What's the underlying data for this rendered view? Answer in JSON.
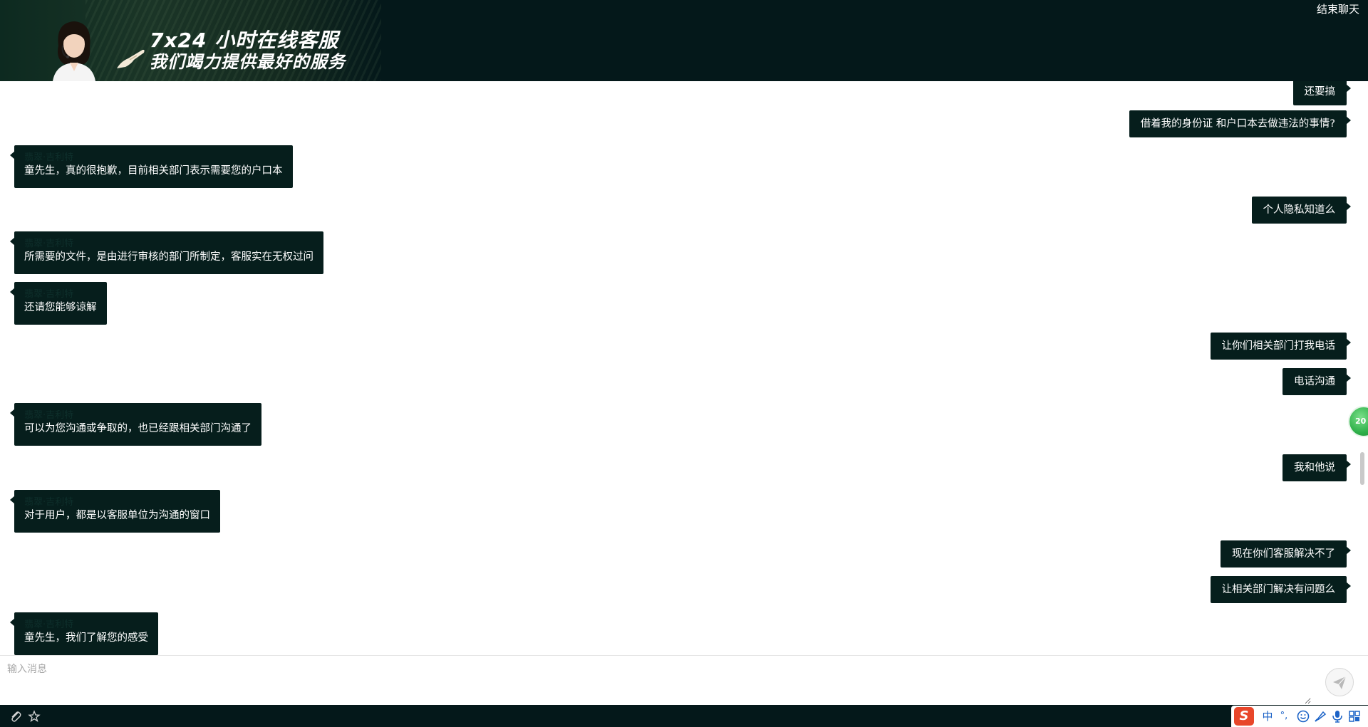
{
  "header": {
    "banner_line1": "7x24 小时在线客服",
    "banner_line2": "我们竭力提供最好的服务",
    "end_chat_label": "结束聊天"
  },
  "messages": [
    {
      "side": "right",
      "text": "还要搞"
    },
    {
      "side": "right",
      "text": "借着我的身份证 和户口本去做违法的事情?"
    },
    {
      "side": "left",
      "sender": "翡翠·吉利特",
      "text": "童先生，真的很抱歉，目前相关部门表示需要您的户口本"
    },
    {
      "side": "right",
      "text": "个人隐私知道么"
    },
    {
      "side": "left",
      "sender": "翡翠·吉利特",
      "text": "所需要的文件，是由进行审核的部门所制定，客服实在无权过问"
    },
    {
      "side": "left",
      "sender": "翡翠·吉利特",
      "text": "还请您能够谅解"
    },
    {
      "side": "right",
      "text": "让你们相关部门打我电话"
    },
    {
      "side": "right",
      "text": "电话沟通"
    },
    {
      "side": "left",
      "sender": "翡翠·吉利特",
      "text": "可以为您沟通或争取的，也已经跟相关部门沟通了"
    },
    {
      "side": "right",
      "text": "我和他说"
    },
    {
      "side": "left",
      "sender": "翡翠·吉利特",
      "text": "对于用户，都是以客服单位为沟通的窗口"
    },
    {
      "side": "right",
      "text": "现在你们客服解决不了"
    },
    {
      "side": "right",
      "text": "让相关部门解决有问题么"
    },
    {
      "side": "left",
      "sender": "翡翠·吉利特",
      "text": "童先生，我们了解您的感受"
    }
  ],
  "float_badge": "20",
  "input": {
    "placeholder": "输入消息",
    "value": ""
  },
  "ime": {
    "logo": "S",
    "mode": "中",
    "punct": "°,"
  },
  "colors": {
    "header_bg": "#04181a",
    "bubble_bg": "#061e1c",
    "sender_name": "#0e2f2b",
    "ime_logo": "#e8462a",
    "ime_icons": "#1c63c7"
  },
  "icons": {
    "attachment": "paperclip-icon",
    "favorite": "star-icon",
    "send": "paper-plane-icon",
    "avatar": "customer-service-agent-avatar",
    "emoji": "smiley-icon",
    "voice": "microphone-icon",
    "keyboard": "grid-icon"
  }
}
